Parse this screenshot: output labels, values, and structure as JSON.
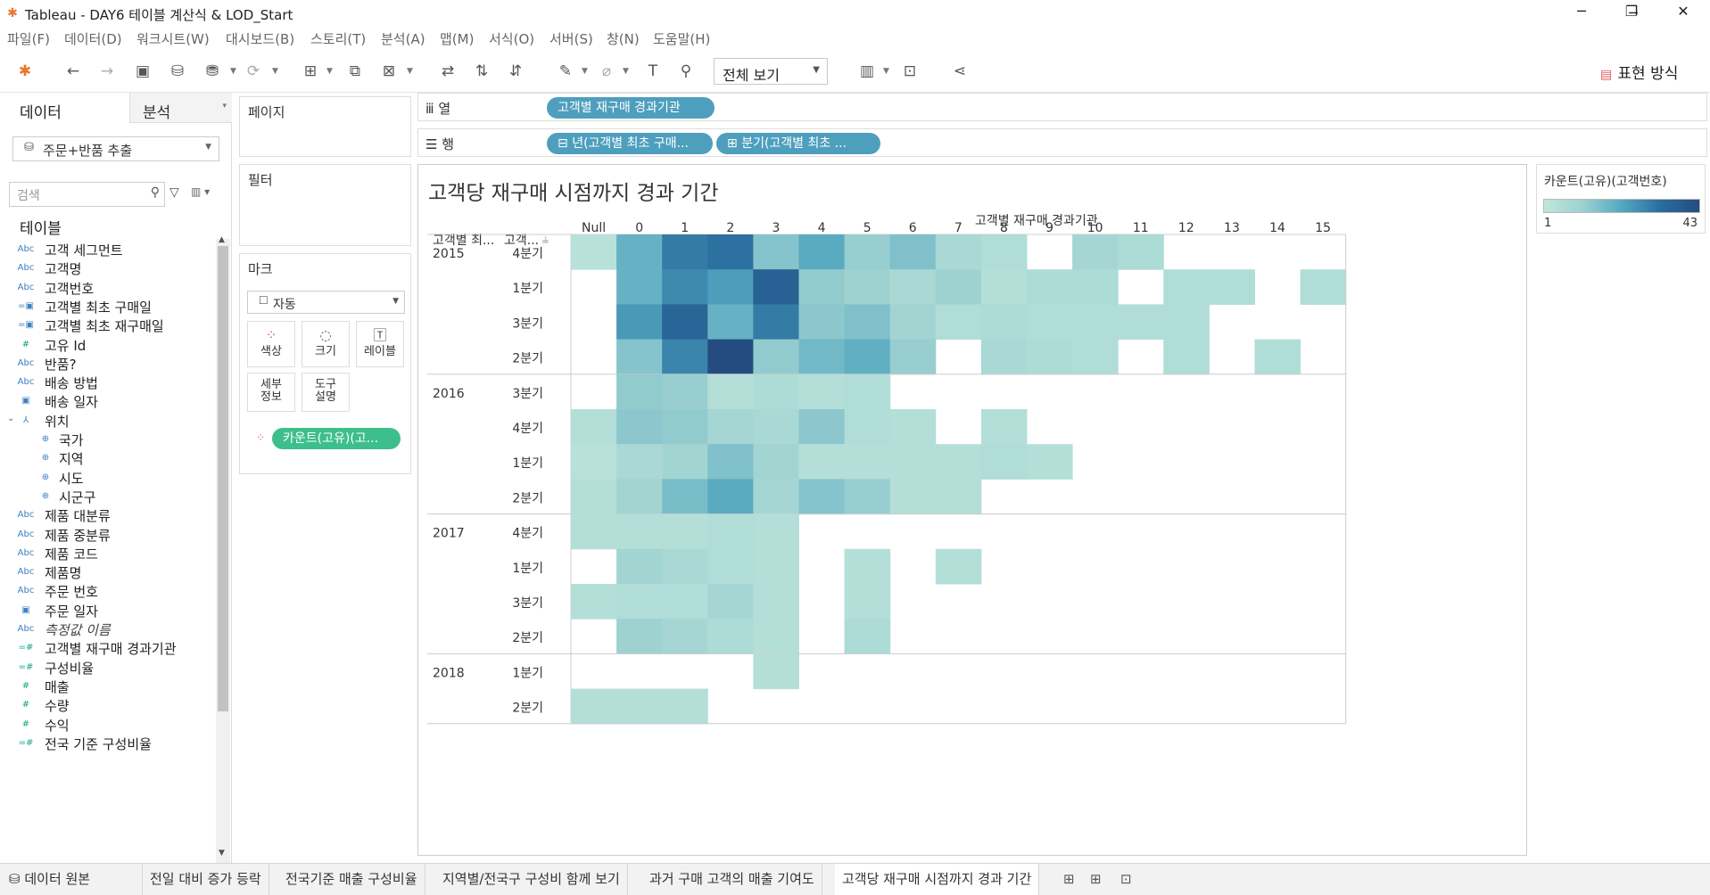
{
  "window": {
    "title": "Tableau - DAY6 테이블 계산식 & LOD_Start",
    "minimize": "─",
    "restore": "❐",
    "close": "✕"
  },
  "menu": [
    "파일(F)",
    "데이터(D)",
    "워크시트(W)",
    "대시보드(B)",
    "스토리(T)",
    "분석(A)",
    "맵(M)",
    "서식(O)",
    "서버(S)",
    "창(N)",
    "도움말(H)"
  ],
  "toolbar": {
    "view_select": "전체 보기",
    "show_me": "표현 방식"
  },
  "left_panel": {
    "tab_data": "데이터",
    "tab_analysis": "분석",
    "datasource": "주문+반품 추출",
    "search_placeholder": "검색",
    "tables_heading": "테이블",
    "fields": [
      {
        "type": "Abc",
        "name": "고객 세그먼트"
      },
      {
        "type": "Abc",
        "name": "고객명"
      },
      {
        "type": "Abc",
        "name": "고객번호"
      },
      {
        "type": "date-calc",
        "name": "고객별 최초 구매일"
      },
      {
        "type": "date-calc",
        "name": "고객별 최초 재구매일"
      },
      {
        "type": "#",
        "name": "고유 Id"
      },
      {
        "type": "Abc",
        "name": "반품?"
      },
      {
        "type": "Abc",
        "name": "배송 방법"
      },
      {
        "type": "date",
        "name": "배송 일자"
      },
      {
        "type": "hier",
        "name": "위치"
      },
      {
        "type": "geo",
        "name": "국가"
      },
      {
        "type": "geo",
        "name": "지역"
      },
      {
        "type": "geo",
        "name": "시도"
      },
      {
        "type": "geo",
        "name": "시군구"
      },
      {
        "type": "Abc",
        "name": "제품 대분류"
      },
      {
        "type": "Abc",
        "name": "제품 중분류"
      },
      {
        "type": "Abc",
        "name": "제품 코드"
      },
      {
        "type": "Abc",
        "name": "제품명"
      },
      {
        "type": "Abc",
        "name": "주문 번호"
      },
      {
        "type": "date",
        "name": "주문 일자"
      },
      {
        "type": "Abc",
        "name": "측정값 이름"
      },
      {
        "type": "=#",
        "name": "고객별 재구매 경과기관"
      },
      {
        "type": "=#",
        "name": "구성비율"
      },
      {
        "type": "#",
        "name": "매출"
      },
      {
        "type": "#",
        "name": "수량"
      },
      {
        "type": "#",
        "name": "수익"
      },
      {
        "type": "=#",
        "name": "전국 기준 구성비율"
      }
    ]
  },
  "cards": {
    "pages": "페이지",
    "filters": "필터",
    "marks": "마크",
    "mark_type": "자동",
    "buttons": {
      "color": "색상",
      "size": "크기",
      "label": "레이블",
      "detail_1": "세부",
      "detail_2": "정보",
      "tooltip_1": "도구",
      "tooltip_2": "설명"
    },
    "color_pill": "카운트(고유)(고..."
  },
  "shelves": {
    "columns_label": "열",
    "rows_label": "행",
    "columns_pill": "고객별 재구매 경과기관",
    "rows_pill_1": "년(고객별 최초 구매...",
    "rows_pill_2": "분기(고객별 최초 ..."
  },
  "view": {
    "title": "고객당 재구매 시점까지 경과 기간",
    "col_field": "고객별 재구매 경과기관",
    "row_header_1": "고객별 최...",
    "row_header_2": "고객..."
  },
  "legend": {
    "title": "카운트(고유)(고객번호)",
    "min": "1",
    "max": "43"
  },
  "bottom_tabs": {
    "datasource": "데이터 원본",
    "sheets": [
      "전일 대비 증가 등락",
      "전국기준 매출 구성비율",
      "지역별/전국구 구성비 함께 보기",
      "과거 구매 고객의 매출 기여도",
      "고객당 재구매 시점까지 경과 기간"
    ],
    "active": 4
  },
  "chart_data": {
    "type": "heatmap",
    "title": "고객당 재구매 시점까지 경과 기간",
    "x_field": "고객별 재구매 경과기관",
    "x": [
      "Null",
      "0",
      "1",
      "2",
      "3",
      "4",
      "5",
      "6",
      "7",
      "8",
      "9",
      "10",
      "11",
      "12",
      "13",
      "14",
      "15"
    ],
    "color_measure": "카운트(고유)(고객번호)",
    "color_range": [
      1,
      43
    ],
    "groups": [
      {
        "year": "2015",
        "rows": [
          {
            "quarter": "4분기",
            "values": [
              3,
              19,
              31,
              33,
              14,
              21,
              11,
              15,
              7,
              5,
              null,
              8,
              6,
              null,
              null,
              null,
              null
            ]
          },
          {
            "quarter": "1분기",
            "values": [
              null,
              19,
              28,
              24,
              37,
              12,
              10,
              7,
              10,
              4,
              6,
              6,
              null,
              5,
              5,
              null,
              5
            ]
          },
          {
            "quarter": "3분기",
            "values": [
              null,
              25,
              36,
              19,
              31,
              13,
              15,
              9,
              5,
              6,
              5,
              5,
              5,
              5,
              null,
              null,
              null
            ]
          },
          {
            "quarter": "2분기",
            "values": [
              null,
              14,
              29,
              43,
              12,
              17,
              20,
              11,
              null,
              7,
              6,
              5,
              null,
              5,
              null,
              5,
              null
            ]
          }
        ]
      },
      {
        "year": "2016",
        "rows": [
          {
            "quarter": "3분기",
            "values": [
              null,
              12,
              11,
              4,
              6,
              4,
              5,
              null,
              null,
              null,
              null,
              null,
              null,
              null,
              null,
              null,
              null
            ]
          },
          {
            "quarter": "4분기",
            "values": [
              4,
              13,
              12,
              8,
              7,
              13,
              5,
              4,
              null,
              4,
              null,
              null,
              null,
              null,
              null,
              null,
              null
            ]
          },
          {
            "quarter": "1분기",
            "values": [
              3,
              7,
              9,
              15,
              9,
              4,
              4,
              4,
              4,
              5,
              4,
              null,
              null,
              null,
              null,
              null,
              null
            ]
          },
          {
            "quarter": "2분기",
            "values": [
              4,
              9,
              16,
              21,
              8,
              14,
              11,
              4,
              4,
              null,
              null,
              null,
              null,
              null,
              null,
              null,
              null
            ]
          }
        ]
      },
      {
        "year": "2017",
        "rows": [
          {
            "quarter": "4분기",
            "values": [
              4,
              4,
              4,
              5,
              4,
              null,
              null,
              null,
              null,
              null,
              null,
              null,
              null,
              null,
              null,
              null,
              null
            ]
          },
          {
            "quarter": "1분기",
            "values": [
              null,
              9,
              7,
              5,
              4,
              null,
              4,
              null,
              4,
              null,
              null,
              null,
              null,
              null,
              null,
              null,
              null
            ]
          },
          {
            "quarter": "3분기",
            "values": [
              4,
              5,
              5,
              8,
              4,
              null,
              4,
              null,
              null,
              null,
              null,
              null,
              null,
              null,
              null,
              null,
              null
            ]
          },
          {
            "quarter": "2분기",
            "values": [
              null,
              10,
              8,
              6,
              4,
              null,
              6,
              null,
              null,
              null,
              null,
              null,
              null,
              null,
              null,
              null,
              null
            ]
          }
        ]
      },
      {
        "year": "2018",
        "rows": [
          {
            "quarter": "1분기",
            "values": [
              null,
              null,
              null,
              null,
              4,
              null,
              null,
              null,
              null,
              null,
              null,
              null,
              null,
              null,
              null,
              null,
              null
            ]
          },
          {
            "quarter": "2분기",
            "values": [
              4,
              4,
              4,
              null,
              null,
              null,
              null,
              null,
              null,
              null,
              null,
              null,
              null,
              null,
              null,
              null,
              null
            ]
          }
        ]
      }
    ]
  }
}
